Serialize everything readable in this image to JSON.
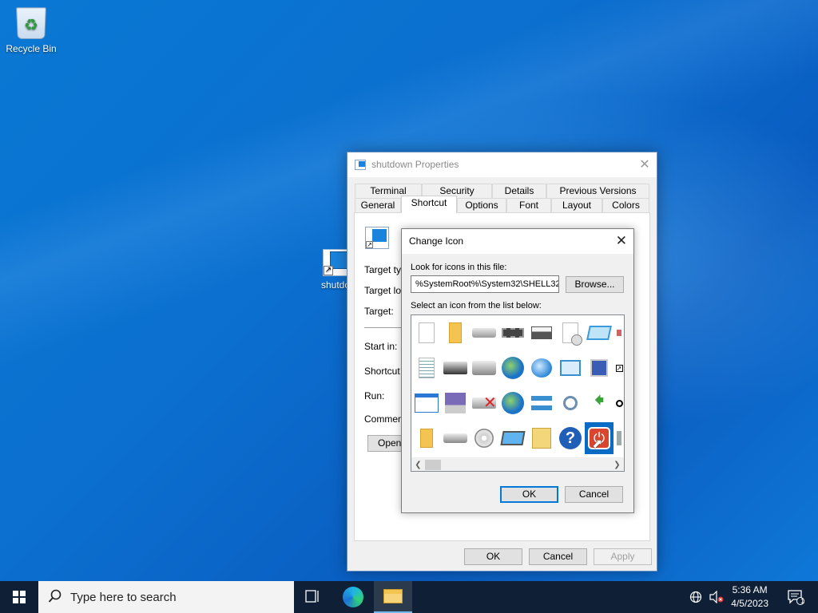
{
  "desktop": {
    "icons": [
      {
        "label": "Recycle Bin",
        "icon": "recycle-bin-icon"
      },
      {
        "label": "shutdo",
        "icon": "shortcut-icon"
      }
    ]
  },
  "properties_window": {
    "title": "shutdown Properties",
    "tabs_row1": [
      "Terminal",
      "Security",
      "Details",
      "Previous Versions"
    ],
    "tabs_row2": [
      "General",
      "Shortcut",
      "Options",
      "Font",
      "Layout",
      "Colors"
    ],
    "active_tab": "Shortcut",
    "fields": {
      "target_type": "Target typ",
      "target_location": "Target loc",
      "target": "Target:",
      "start_in": "Start in:",
      "shortcut_key": "Shortcut k",
      "run": "Run:",
      "comment": "Comment:"
    },
    "open_button": "Open",
    "buttons": {
      "ok": "OK",
      "cancel": "Cancel",
      "apply": "Apply"
    }
  },
  "change_icon_dialog": {
    "title": "Change Icon",
    "look_for_label": "Look for icons in this file:",
    "path_value": "%SystemRoot%\\System32\\SHELL32.dll",
    "browse_button": "Browse...",
    "select_label": "Select an icon from the list below:",
    "icons": [
      "blank-document-icon",
      "folder-icon",
      "drive-icon",
      "memory-chip-icon",
      "printer-icon",
      "clock-document-icon",
      "card-icon",
      "partial-icon",
      "text-document-icon",
      "network-drive-icon",
      "server-icon",
      "globe-icon",
      "network-globe-icon",
      "desktop-settings-icon",
      "app-window-icon",
      "shortcut-arrow-icon",
      "window-icon",
      "floppy-icon",
      "disconnected-drive-icon",
      "mouse-globe-icon",
      "network-icon",
      "search-icon",
      "green-arrow-icon",
      "clock-small-icon",
      "folder-closed-icon",
      "drive-hd-icon",
      "cd-drive-icon",
      "laptop-icon",
      "keypad-folder-icon",
      "help-icon",
      "shutdown-icon",
      "partial-icon-2"
    ],
    "selected_icon": "shutdown-icon",
    "ok_button": "OK",
    "cancel_button": "Cancel"
  },
  "taskbar": {
    "search_placeholder": "Type here to search",
    "time": "5:36 AM",
    "date": "4/5/2023",
    "notification_count": "1"
  }
}
